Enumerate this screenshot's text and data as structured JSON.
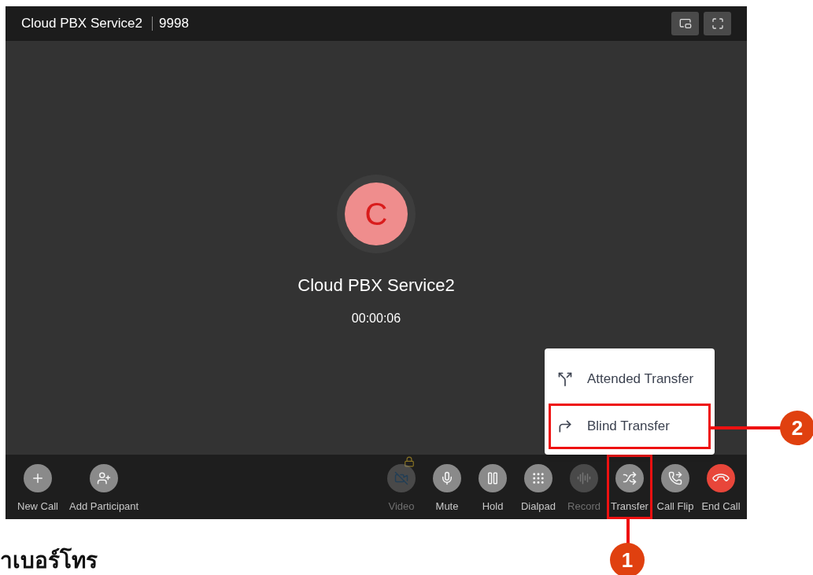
{
  "window": {
    "title": "Cloud PBX Service2",
    "number": "9998"
  },
  "call": {
    "avatar_letter": "C",
    "name": "Cloud PBX Service2",
    "timer": "00:00:06"
  },
  "toolbar_left": [
    {
      "kind": "newcall",
      "label": "New Call",
      "disabled": false
    },
    {
      "kind": "addparticipant",
      "label": "Add Participant",
      "disabled": false
    }
  ],
  "toolbar_right": [
    {
      "kind": "video",
      "label": "Video",
      "disabled": true,
      "locked": true,
      "highlighted": false
    },
    {
      "kind": "mute",
      "label": "Mute",
      "disabled": false,
      "locked": false,
      "highlighted": false
    },
    {
      "kind": "hold",
      "label": "Hold",
      "disabled": false,
      "locked": false,
      "highlighted": false
    },
    {
      "kind": "dialpad",
      "label": "Dialpad",
      "disabled": false,
      "locked": false,
      "highlighted": false
    },
    {
      "kind": "record",
      "label": "Record",
      "disabled": true,
      "locked": false,
      "highlighted": false
    },
    {
      "kind": "transfer",
      "label": "Transfer",
      "disabled": false,
      "locked": false,
      "highlighted": true
    },
    {
      "kind": "flip",
      "label": "Call Flip",
      "disabled": false,
      "locked": false,
      "highlighted": false
    },
    {
      "kind": "end",
      "label": "End Call",
      "disabled": false,
      "locked": false,
      "highlighted": false
    }
  ],
  "transfer_menu": [
    {
      "kind": "attended",
      "label": "Attended Transfer",
      "highlighted": false
    },
    {
      "kind": "blind",
      "label": "Blind Transfer",
      "highlighted": true
    }
  ],
  "callouts": [
    {
      "label": "1"
    },
    {
      "label": "2"
    }
  ],
  "caption": "าเบอร์โทร"
}
